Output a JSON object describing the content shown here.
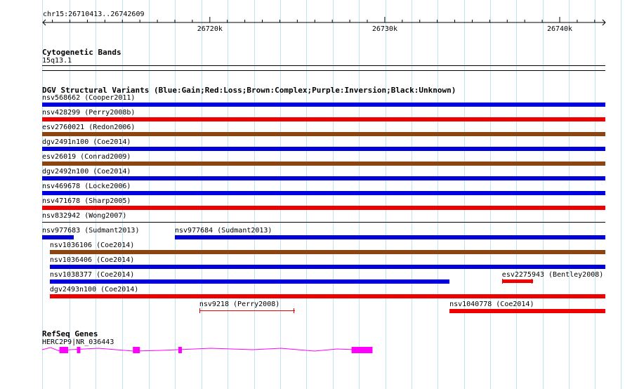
{
  "ruler": {
    "location": "chr15:26710413..26742609",
    "ticks": [
      "26720k",
      "26730k",
      "26740k"
    ]
  },
  "tracks": {
    "cytoband": {
      "title": "Cytogenetic Bands",
      "band": "15q13.1"
    },
    "dgv": {
      "title": "DGV Structural Variants (Blue:Gain;Red:Loss;Brown:Complex;Purple:Inversion;Black:Unknown)",
      "variants": [
        {
          "label": "nsv568662 (Cooper2011)",
          "type": "gain",
          "start": 26710413,
          "end": 26742609
        },
        {
          "label": "nsv428299 (Perry2008b)",
          "type": "loss",
          "start": 26710413,
          "end": 26742609
        },
        {
          "label": "esv2760021 (Redon2006)",
          "type": "complex",
          "start": 26710413,
          "end": 26742609
        },
        {
          "label": "dgv2491n100 (Coe2014)",
          "type": "gain",
          "start": 26710413,
          "end": 26742609
        },
        {
          "label": "esv26019 (Conrad2009)",
          "type": "complex",
          "start": 26710413,
          "end": 26742609
        },
        {
          "label": "dgv2492n100 (Coe2014)",
          "type": "gain",
          "start": 26710413,
          "end": 26742609
        },
        {
          "label": "nsv469678 (Locke2006)",
          "type": "gain",
          "start": 26710413,
          "end": 26742609
        },
        {
          "label": "nsv471678 (Sharp2005)",
          "type": "loss",
          "start": 26710413,
          "end": 26742609
        },
        {
          "label": "nsv832942 (Wong2007)",
          "type": "unknown",
          "start": 26710413,
          "end": 26742609
        },
        {
          "label": "nsv977683 (Sudmant2013)",
          "type": "gain",
          "start": 26710413,
          "end": 26712200
        },
        {
          "label": "nsv977684 (Sudmant2013)",
          "type": "gain",
          "start": 26718000,
          "end": 26742609
        },
        {
          "label": "nsv1036106 (Coe2014)",
          "type": "complex",
          "start": 26710850,
          "end": 26742609
        },
        {
          "label": "nsv1036406 (Coe2014)",
          "type": "gain",
          "start": 26710850,
          "end": 26742609
        },
        {
          "label": "nsv1038377 (Coe2014)",
          "type": "gain",
          "start": 26710850,
          "end": 26733700
        },
        {
          "label": "esv2275943 (Bentley2008)",
          "type": "loss",
          "start": 26736700,
          "end": 26738400
        },
        {
          "label": "dgv2493n100 (Coe2014)",
          "type": "loss",
          "start": 26710850,
          "end": 26742609
        },
        {
          "label": "nsv9218 (Perry2008)",
          "type": "loss",
          "start": 26719400,
          "end": 26724800
        },
        {
          "label": "nsv1040778 (Coe2014)",
          "type": "loss",
          "start": 26733700,
          "end": 26742609
        }
      ]
    },
    "refseq": {
      "title": "RefSeq Genes",
      "genes": [
        {
          "label": "HERC2P9|NR_036443",
          "start": 26710413,
          "end": 26729300,
          "exons": [
            [
              26711400,
              26711900
            ],
            [
              26712400,
              26712600
            ],
            [
              26715600,
              26716000
            ],
            [
              26718200,
              26718400
            ],
            [
              26728100,
              26729300
            ]
          ]
        }
      ]
    }
  },
  "colors": {
    "gain": "#0000dd",
    "loss": "#ee0000",
    "complex": "#8b4513",
    "inversion": "#800080",
    "unknown": "#000000",
    "gene": "#ff00ff",
    "grid": "#bfe3ef"
  }
}
